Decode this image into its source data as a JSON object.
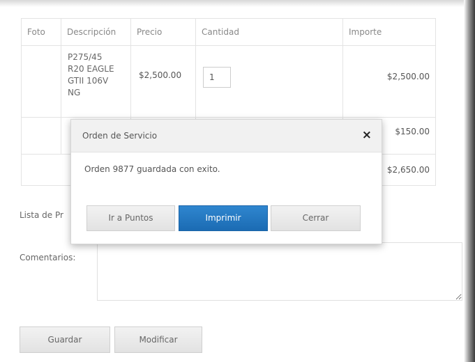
{
  "table": {
    "headers": [
      "Foto",
      "Descripción",
      "Precio",
      "Cantidad",
      "Importe"
    ],
    "row1": {
      "descripcion": "P275/45\nR20 EAGLE\nGTII 106V\nNG",
      "precio": "$2,500.00",
      "cantidad": "1",
      "importe": "$2,500.00"
    },
    "row2": {
      "importe": "$150.00"
    },
    "total": "$2,650.00"
  },
  "labels": {
    "lista": "Lista de Pr",
    "comentarios": "Comentarios:"
  },
  "buttons": {
    "guardar": "Guardar",
    "modificar": "Modificar"
  },
  "modal": {
    "title": "Orden de Servicio",
    "close": "×",
    "message": "Orden 9877 guardada con exito.",
    "btn_puntos": "Ir a Puntos",
    "btn_imprimir": "Imprimir",
    "btn_cerrar": "Cerrar"
  },
  "colors": {
    "primary_button": "#1f72bd",
    "default_button": "#e8e8e8"
  }
}
